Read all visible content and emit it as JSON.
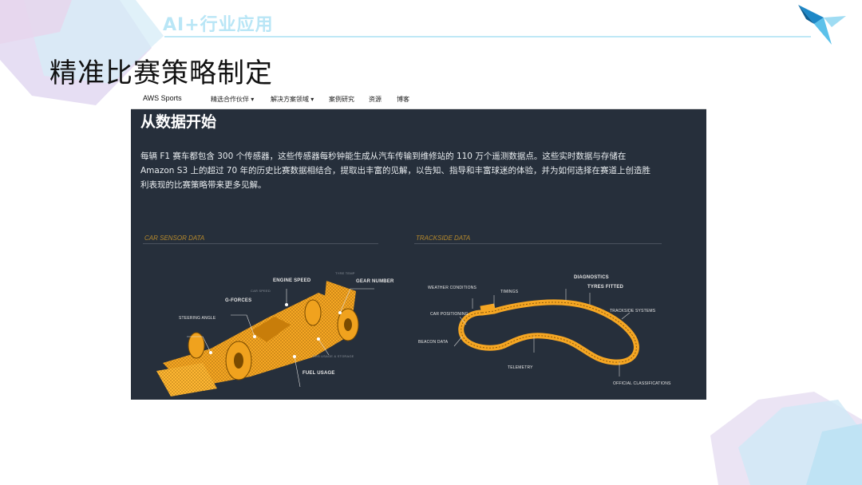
{
  "slide": {
    "header": "AI+行业应用",
    "title": "精准比赛策略制定"
  },
  "aws_page": {
    "nav": {
      "brand": "AWS Sports",
      "items": [
        {
          "label": "精选合作伙伴 ▾"
        },
        {
          "label": "解决方案领域 ▾"
        },
        {
          "label": "案例研究"
        },
        {
          "label": "资源"
        },
        {
          "label": "博客"
        }
      ]
    },
    "headline": "从数据开始",
    "body_lines": [
      "每辆 F1 赛车都包含 300 个传感器，这些传感器每秒钟能生成从汽车传输到维修站的 110 万个遥测数据点。这些实时数据与存储在",
      "Amazon S3 上的超过 70 年的历史比赛数据相结合，提取出丰富的见解，以告知、指导和丰富球迷的体验，并为如何选择在赛道上创造胜",
      "利表现的比赛策略带来更多见解。"
    ],
    "car_section": {
      "label": "CAR SENSOR DATA",
      "callouts": {
        "engine_speed": "ENGINE SPEED",
        "gear_number": "GEAR NUMBER",
        "g_forces": "G-FORCES",
        "steering_angle": "STEERING ANGLE",
        "fuel_usage": "FUEL USAGE",
        "tyre_temp": "TYRE TEMP",
        "car_speed": "CAR SPEED",
        "ers": "ERS USAGE & STORAGE"
      }
    },
    "track_section": {
      "label": "TRACKSIDE DATA",
      "callouts": {
        "weather": "WEATHER CONDITIONS",
        "timings": "TIMINGS",
        "diagnostics": "DIAGNOSTICS",
        "tyres_fitted": "TYRES FITTED",
        "trackside_systems": "TRACKSIDE SYSTEMS",
        "car_positioning": "CAR POSITIONING",
        "beacon_data": "BEACON DATA",
        "telemetry": "TELEMETRY",
        "official_classifications": "OFFICIAL CLASSIFICATIONS"
      }
    }
  },
  "colors": {
    "panel_bg": "#262f3b",
    "accent_orange": "#f5a623",
    "header_cyan": "#b9e6f6"
  }
}
